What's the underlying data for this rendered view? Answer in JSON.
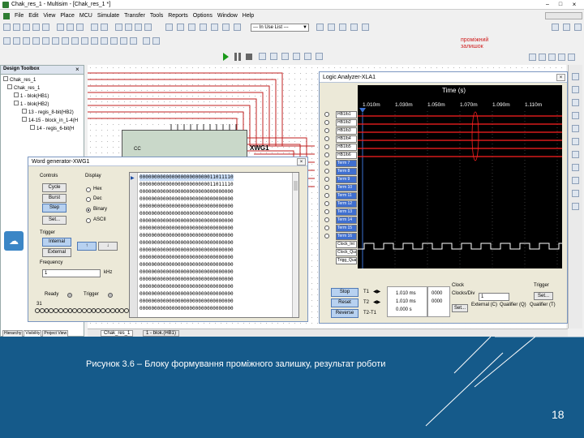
{
  "app": {
    "title": "Chak_res_1 - Multisim - [Chak_res_1 *]"
  },
  "menu": [
    "File",
    "Edit",
    "View",
    "Place",
    "MCU",
    "Simulate",
    "Transfer",
    "Tools",
    "Reports",
    "Options",
    "Window",
    "Help"
  ],
  "toolbar": {
    "in_use_list": "--- In Use List ---"
  },
  "annotation": {
    "line1": "проміжний",
    "line2": "залишок"
  },
  "design_toolbox": {
    "title": "Design Toolbox",
    "tree": [
      "Chak_res_1",
      "Chak_res_1",
      "1 - blok(HB1)",
      "1 - blok(HB2)",
      "13 - regis_8-bit(HB2)",
      "14-15 - block_in_1-4(H",
      "14 - regis_6-bit(H"
    ],
    "tabs": [
      "Hierarchy",
      "Visibility",
      "Project View"
    ]
  },
  "doc_tabs": [
    "Chak_res_1",
    "1 - blok.(HB1)"
  ],
  "component": {
    "label": "XWG1",
    "pin_label": "CC"
  },
  "word_generator": {
    "title": "Word generator-XWG1",
    "controls_label": "Controls",
    "controls": [
      "Cycle",
      "Burst",
      "Step",
      "Set..."
    ],
    "display_label": "Display",
    "display_options": [
      "Hex",
      "Dec",
      "Binary",
      "ASCII"
    ],
    "display_selected": "Binary",
    "trigger_label": "Trigger",
    "trigger_buttons": [
      "Internal",
      "External"
    ],
    "edge_buttons": [
      "↑",
      "↓"
    ],
    "frequency_label": "Frequency",
    "frequency_value": "1",
    "frequency_unit": "kHz",
    "ready_label": "Ready",
    "trigger_status_label": "Trigger",
    "bit_left": "31",
    "bit_right": "0",
    "words": [
      "00000000000000000000000011011110",
      "00000000000000000000000011011110",
      "00000000000000000000000000000000",
      "00000000000000000000000000000000",
      "00000000000000000000000000000000",
      "00000000000000000000000000000000",
      "00000000000000000000000000000000",
      "00000000000000000000000000000000",
      "00000000000000000000000000000000",
      "00000000000000000000000000000000",
      "00000000000000000000000000000000",
      "00000000000000000000000000000000",
      "00000000000000000000000000000000",
      "00000000000000000000000000000000",
      "00000000000000000000000000000000",
      "00000000000000000000000000000000",
      "00000000000000000000000000000000",
      "00000000000000000000000000000000",
      "00000000000000000000000000000000"
    ]
  },
  "logic_analyzer": {
    "title": "Logic Analyzer-XLA1",
    "time_label": "Time (s)",
    "time_ticks": [
      "1.010m",
      "1.030m",
      "1.050m",
      "1.070m",
      "1.090m",
      "1.110m"
    ],
    "signals": [
      "HB1/b1",
      "HB1/b2",
      "HB1/b3",
      "HB1/b4",
      "HB1/b5",
      "HB1/b6",
      "Term 7",
      "Term 8",
      "Term 9",
      "Term 10",
      "Term 11",
      "Term 12",
      "Term 13",
      "Term 14",
      "Term 15",
      "Term 16",
      "Clock_Int",
      "Clock_Qua",
      "Trigg_Qua"
    ],
    "buttons": [
      "Stop",
      "Reset",
      "Reverse"
    ],
    "t1_label": "T1",
    "t2_label": "T2",
    "t2t1_label": "T2-T1",
    "t1_time": "1.010 ms",
    "t2_time": "1.010 ms",
    "dt_time": "0.000 s",
    "t1_value": "0000",
    "t2_value": "0000",
    "clock_label": "Clock",
    "clocks_div_label": "Clocks/Div",
    "clocks_div_value": "1",
    "clock_set": "Set...",
    "external_label": "External (C)",
    "qualifier_c": "Qualifier (Q)",
    "trigger_label": "Trigger",
    "trigger_set": "Set...",
    "qualifier_t": "Qualifier (T)"
  },
  "slide": {
    "caption": "Рисунок 3.6 – Блоку формування проміжного залишку, результат роботи",
    "page_number": "18"
  },
  "colors": {
    "slide_blue": "#155a8a",
    "trace_red": "#ff2020",
    "trace_white": "#ffffff",
    "wire_red": "#c02020",
    "plot_bg": "#000000"
  }
}
